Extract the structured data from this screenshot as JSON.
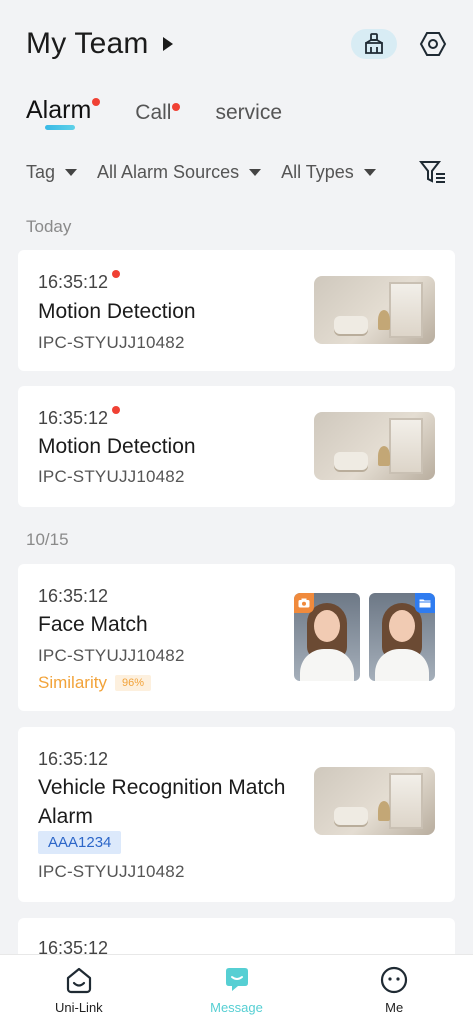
{
  "header": {
    "title": "My Team"
  },
  "tabs": [
    {
      "label": "Alarm",
      "active": true,
      "has_dot": true
    },
    {
      "label": "Call",
      "active": false,
      "has_dot": true
    },
    {
      "label": "service",
      "active": false,
      "has_dot": false
    }
  ],
  "filters": {
    "tag": "Tag",
    "sources": "All Alarm Sources",
    "types": "All Types"
  },
  "sections": {
    "today": "Today",
    "date": "10/15"
  },
  "alarms": [
    {
      "time": "16:35:12",
      "unread": true,
      "name": "Motion Detection",
      "device": "IPC-STYUJJ10482"
    },
    {
      "time": "16:35:12",
      "unread": true,
      "name": "Motion Detection",
      "device": "IPC-STYUJJ10482"
    },
    {
      "time": "16:35:12",
      "unread": false,
      "name": "Face Match",
      "device": "IPC-STYUJJ10482",
      "similarity_label": "Similarity",
      "similarity_value": "96%"
    },
    {
      "time": "16:35:12",
      "unread": false,
      "name_line1": "Vehicle Recognition Match",
      "name_line2": "Alarm",
      "plate": "AAA1234",
      "device": "IPC-STYUJJ10482"
    },
    {
      "time": "16:35:12"
    }
  ],
  "bottom_nav": [
    {
      "label": "Uni-Link",
      "icon": "home-icon",
      "active": false
    },
    {
      "label": "Message",
      "icon": "message-icon",
      "active": true
    },
    {
      "label": "Me",
      "icon": "profile-icon",
      "active": false
    }
  ],
  "colors": {
    "accent": "#56cfd3",
    "alert_dot": "#f04134",
    "similarity": "#f2a33a",
    "plate_text": "#2c66c8"
  }
}
